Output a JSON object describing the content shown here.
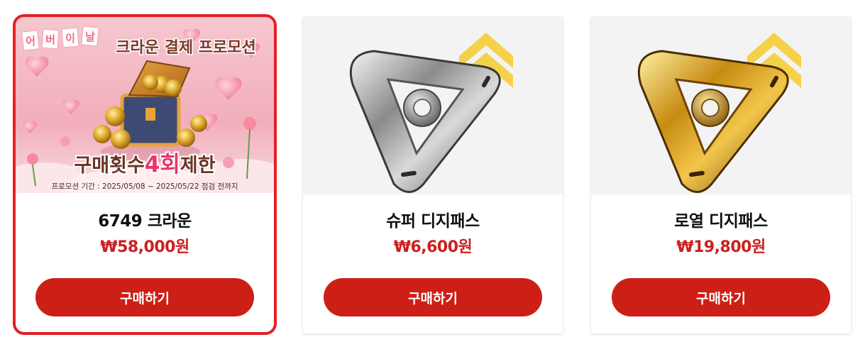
{
  "cards": [
    {
      "name": "6749 크라운",
      "price": "₩58,000원",
      "button_label": "구매하기",
      "banner": {
        "event_tag": "어버이날",
        "event_tag_chars": [
          "어",
          "버",
          "이",
          "날"
        ],
        "headline": "크라운 결제 프로모션",
        "limit_prefix": "구매횟수",
        "limit_highlight": "4회",
        "limit_suffix": "제한",
        "period": "프로모션 기간 : 2025/05/08 ~ 2025/05/22 점검 전까지"
      },
      "selected": true
    },
    {
      "name": "슈퍼 디지패스",
      "price": "₩6,600원",
      "button_label": "구매하기",
      "item_icon": "silver-digipass-icon"
    },
    {
      "name": "로열 디지패스",
      "price": "₩19,800원",
      "button_label": "구매하기",
      "item_icon": "gold-digipass-icon"
    }
  ],
  "colors": {
    "accent_red": "#cc1f16",
    "price_red": "#cc1f1f",
    "selected_border": "#e32025",
    "rank_chevron": "#f5d14a"
  }
}
